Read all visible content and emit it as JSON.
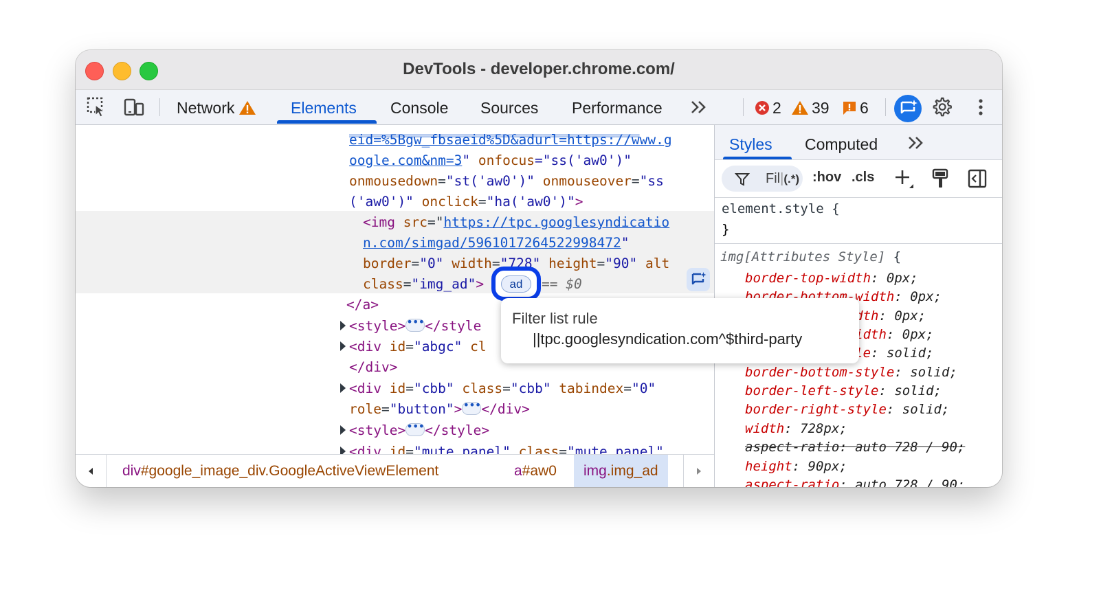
{
  "window": {
    "title": "DevTools - developer.chrome.com/"
  },
  "toolbar": {
    "tabs": [
      "Network",
      "Elements",
      "Console",
      "Sources",
      "Performance"
    ],
    "more_tabs": "»",
    "counts": {
      "errors": "2",
      "warnings": "39",
      "issues": "6"
    }
  },
  "elements": {
    "lines": {
      "l0": {
        "link": "eid=%5Bgw_fbsaeid%5D&adurl=https://www.g"
      },
      "l1": {
        "link": "oogle.com&nm=3",
        "rest_a": "\" ",
        "attr": "onfocus",
        "eq": "=\"",
        "val": "ss('aw0')",
        "close": "\""
      },
      "l2": {
        "attr1": "onmousedown",
        "val1": "\"st('aw0')\"",
        "attr2": "onmouseover",
        "val2": "\"ss"
      },
      "l3": {
        "val": "('aw0')\"",
        "attr": "onclick",
        "val2": "\"ha('aw0')\"",
        "tail": ">"
      },
      "l4": {
        "tag": "<img",
        "attr": "src",
        "link": "https://tpc.googlesyndicatio"
      },
      "l5": {
        "link": "n.com/simgad/5961017264522998472",
        "close": "\""
      },
      "l6": {
        "a1": "border",
        "v1": "\"0\"",
        "a2": "width",
        "v2": "\"728\"",
        "a3": "height",
        "v3": "\"90\"",
        "a4": "alt"
      },
      "l7": {
        "attr": "class",
        "val": "\"img_ad\"",
        "tag_end": ">",
        "eq_marker": "== $0"
      },
      "l8": {
        "tag": "</a>"
      },
      "l9": {
        "open": "<style>",
        "close": "</style"
      },
      "l10": {
        "tag": "<div",
        "attr": "id",
        "val": "\"abgc\"",
        "more": "cl"
      },
      "l11": {
        "tag": "</div>"
      },
      "l12": {
        "tag": "<div",
        "a1": "id",
        "v1": "\"cbb\"",
        "a2": "class",
        "v2": "\"cbb\"",
        "a3": "tabindex",
        "v3": "\"0\""
      },
      "l13": {
        "attr": "role",
        "val": "\"button\"",
        "gt": ">",
        "close": "</div>"
      },
      "l14": {
        "open": "<style>",
        "close": "</style>"
      },
      "l15": {
        "tag": "<div",
        "a1": "id",
        "v1": "\"mute_panel\"",
        "a2": "class",
        "v2": "\"mute_panel\""
      }
    },
    "ad_badge": "ad",
    "tooltip": {
      "title": "Filter list rule",
      "rule": "||tpc.googlesyndication.com^$third-party"
    }
  },
  "breadcrumbs": [
    {
      "tag": "div",
      "suffix": "#google_image_div.GoogleActiveViewElement"
    },
    {
      "tag": "a",
      "suffix": "#aw0"
    },
    {
      "tag": "img",
      "suffix": ".img_ad"
    }
  ],
  "styles": {
    "tabs": [
      "Styles",
      "Computed"
    ],
    "more": "»",
    "filter": {
      "placeholder": "Fil",
      "regex": "(.*)"
    },
    "tools": {
      "hov": ":hov",
      "cls": ".cls"
    },
    "element_style": {
      "selector": "element.style",
      "open": " {",
      "close": "}"
    },
    "attr_rule": {
      "selector": "img[Attributes Style]",
      "open": " {"
    },
    "declarations": [
      {
        "prop": "border-top-width",
        "val": "0px"
      },
      {
        "prop": "border-bottom-width",
        "val": "0px"
      },
      {
        "prop": "border-left-width",
        "val": "0px"
      },
      {
        "prop": "border-right-width",
        "val": "0px"
      },
      {
        "prop": "border-top-style",
        "val": "solid"
      },
      {
        "prop": "border-bottom-style",
        "val": "solid"
      },
      {
        "prop": "border-left-style",
        "val": "solid"
      },
      {
        "prop": "border-right-style",
        "val": "solid"
      },
      {
        "prop": "width",
        "val": "728px"
      },
      {
        "prop": "aspect-ratio",
        "val": "auto 728 / 90"
      },
      {
        "prop": "height",
        "val": "90px"
      },
      {
        "prop": "aspect-ratio",
        "val": "auto 728 / 90"
      }
    ]
  }
}
